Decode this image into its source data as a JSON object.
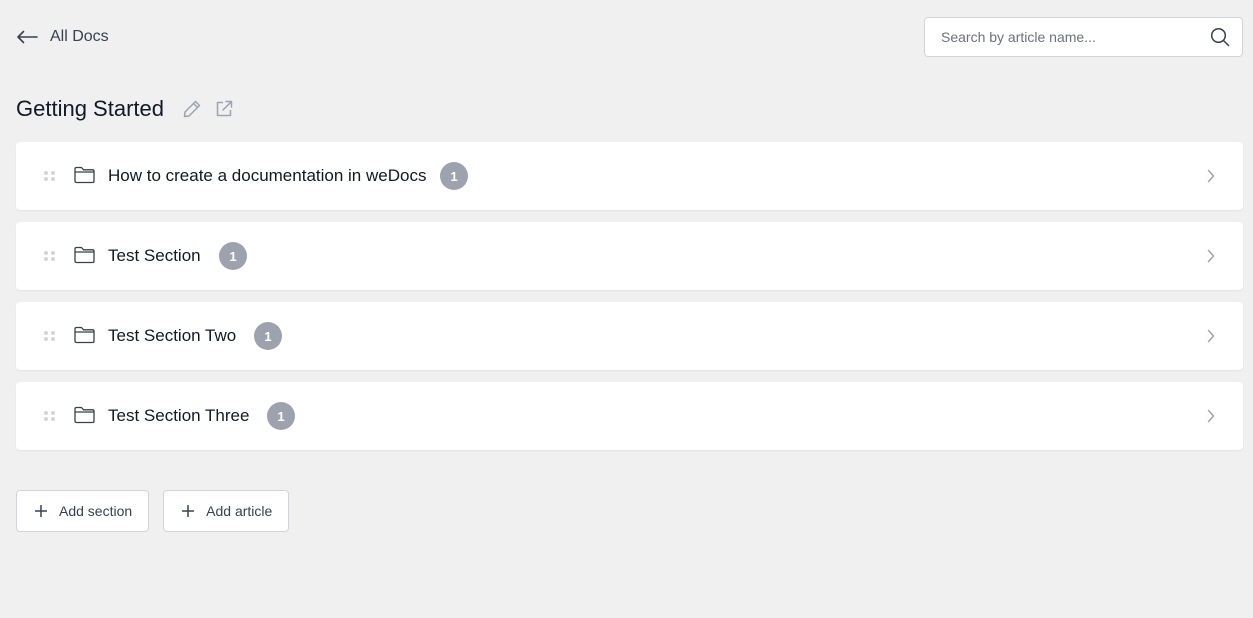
{
  "header": {
    "back_label": "All Docs",
    "back_icon": "arrow-left-icon"
  },
  "search": {
    "placeholder": "Search by article name...",
    "value": "",
    "icon": "search-icon"
  },
  "doc": {
    "title": "Getting Started",
    "edit_icon": "pencil-icon",
    "open_icon": "external-link-icon"
  },
  "sections": [
    {
      "label": "How to create a documentation in weDocs",
      "count": "1"
    },
    {
      "label": "Test Section",
      "count": "1"
    },
    {
      "label": "Test Section Two",
      "count": "1"
    },
    {
      "label": "Test Section Three",
      "count": "1"
    }
  ],
  "actions": {
    "add_section": "Add section",
    "add_article": "Add article"
  },
  "colors": {
    "background": "#f0f0f1",
    "badge": "#9ca3af",
    "text": "#111827"
  }
}
